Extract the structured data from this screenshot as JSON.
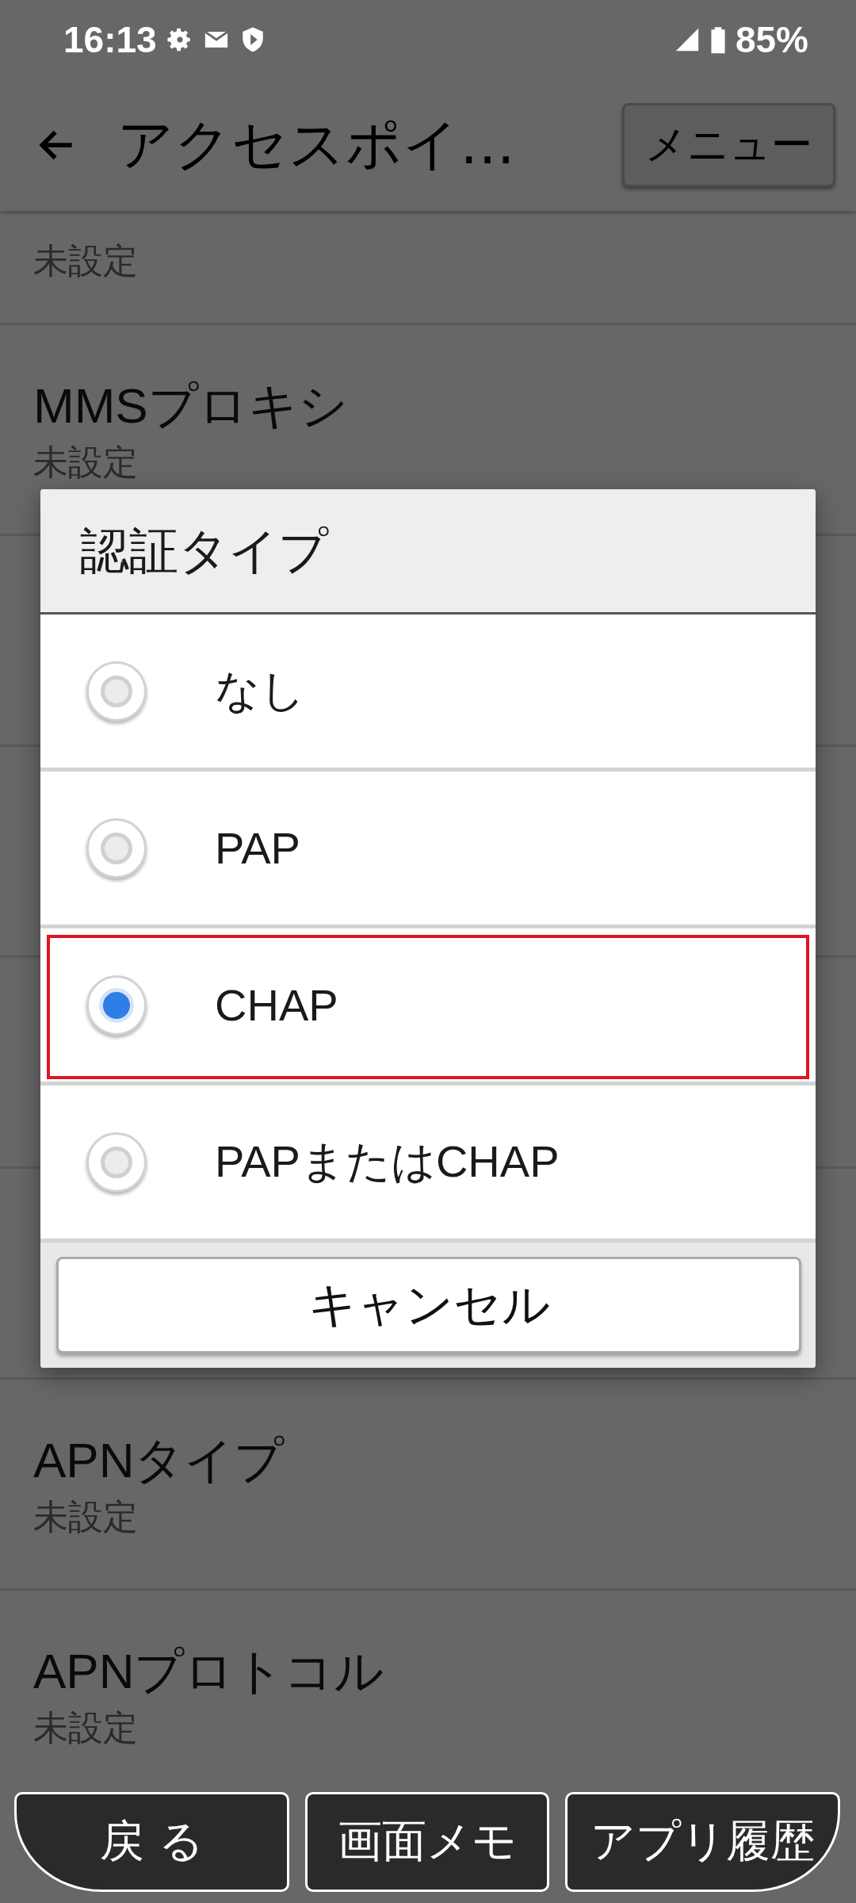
{
  "status_bar": {
    "time": "16:13",
    "battery": "85%"
  },
  "toolbar": {
    "title": "アクセスポイ…",
    "menu_button": "メニュー"
  },
  "settings": [
    {
      "kind": "row",
      "value": "未設定"
    },
    {
      "kind": "row",
      "title": "MMSプロキシ",
      "value": "未設定"
    },
    {
      "kind": "covered"
    },
    {
      "kind": "covered"
    },
    {
      "kind": "covered"
    },
    {
      "kind": "covered"
    },
    {
      "kind": "row",
      "title": "APNタイプ",
      "value": "未設定"
    },
    {
      "kind": "row",
      "title": "APNプロトコル",
      "value": "未設定"
    }
  ],
  "dialog": {
    "title": "認証タイプ",
    "options": [
      {
        "label": "なし",
        "selected": false,
        "focused": false
      },
      {
        "label": "PAP",
        "selected": false,
        "focused": false
      },
      {
        "label": "CHAP",
        "selected": true,
        "focused": true
      },
      {
        "label": "PAPまたはCHAP",
        "selected": false,
        "focused": false
      }
    ],
    "cancel_button": "キャンセル"
  },
  "nav_buttons": [
    "戻 る",
    "画面メモ",
    "アプリ履歴"
  ]
}
